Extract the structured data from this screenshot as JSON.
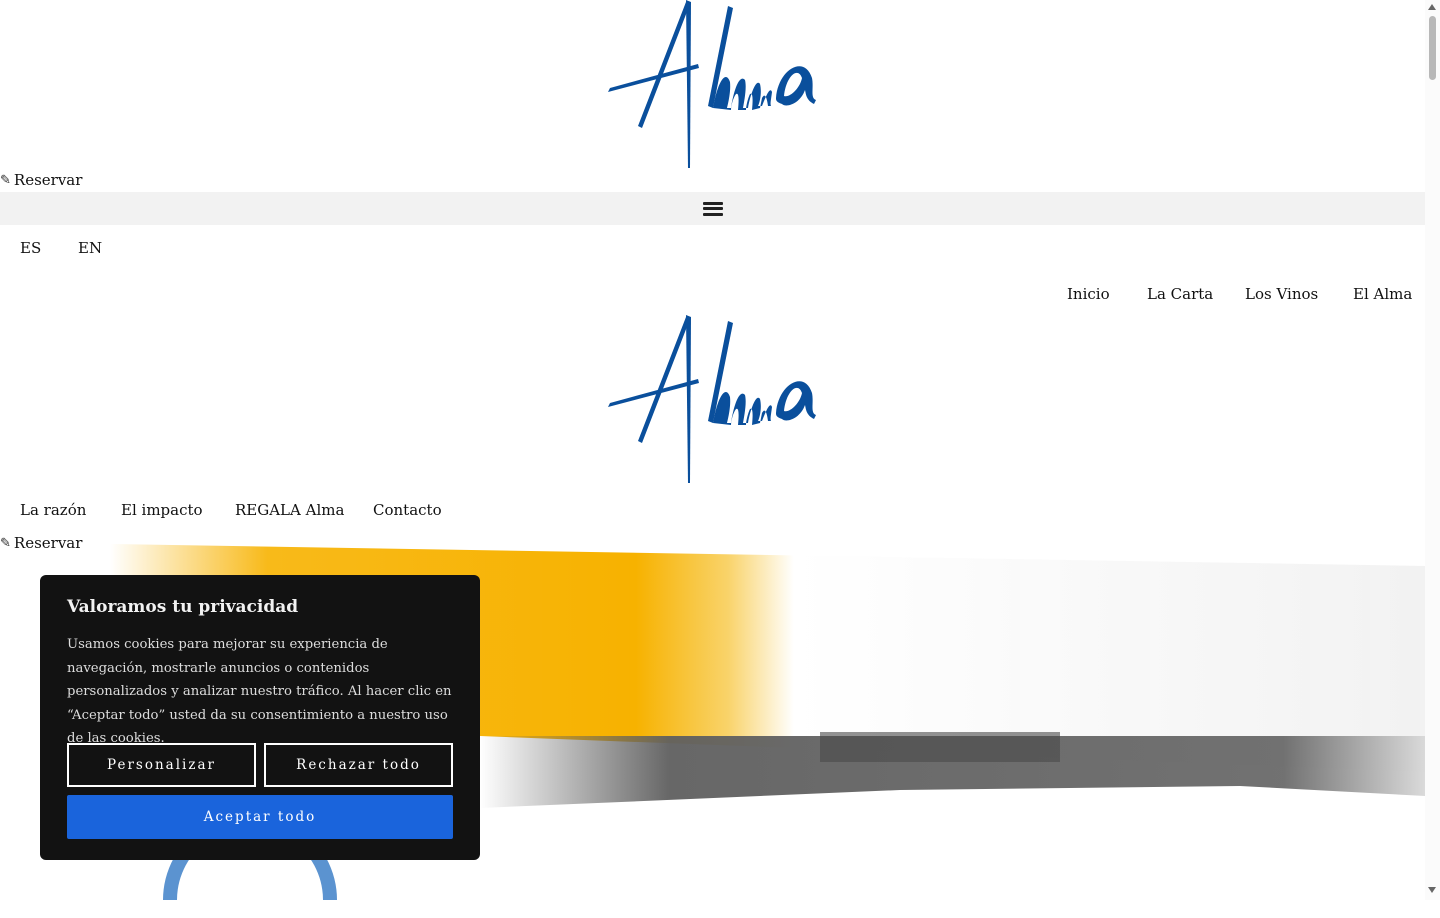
{
  "brand": {
    "logo_text": "Alma",
    "logo_color": "#0a4f9c"
  },
  "reserve_top": {
    "label": "Reservar"
  },
  "reserve_bottom": {
    "label": "Reservar"
  },
  "languages": [
    {
      "label": "ES"
    },
    {
      "label": "EN"
    }
  ],
  "nav_right": [
    {
      "label": "Inicio"
    },
    {
      "label": "La Carta"
    },
    {
      "label": "Los Vinos"
    },
    {
      "label": "El Alma"
    }
  ],
  "nav_left": [
    {
      "label": "La razón"
    },
    {
      "label": "El impacto"
    },
    {
      "label": "REGALA Alma"
    },
    {
      "label": "Contacto"
    }
  ],
  "cookie": {
    "title": "Valoramos tu privacidad",
    "body": "Usamos cookies para mejorar su experiencia de navegación, mostrarle anuncios o contenidos personalizados y analizar nuestro tráfico. Al hacer clic en “Aceptar todo” usted da su consentimiento a nuestro uso de las cookies.",
    "customize_label": "Personalizar",
    "reject_label": "Rechazar todo",
    "accept_label": "Aceptar todo",
    "accent_color": "#1a64dc"
  },
  "colors": {
    "hero_yellow": "#f7b200",
    "hero_gray": "#5f5f5f",
    "hero_light": "#f2f2f2"
  }
}
